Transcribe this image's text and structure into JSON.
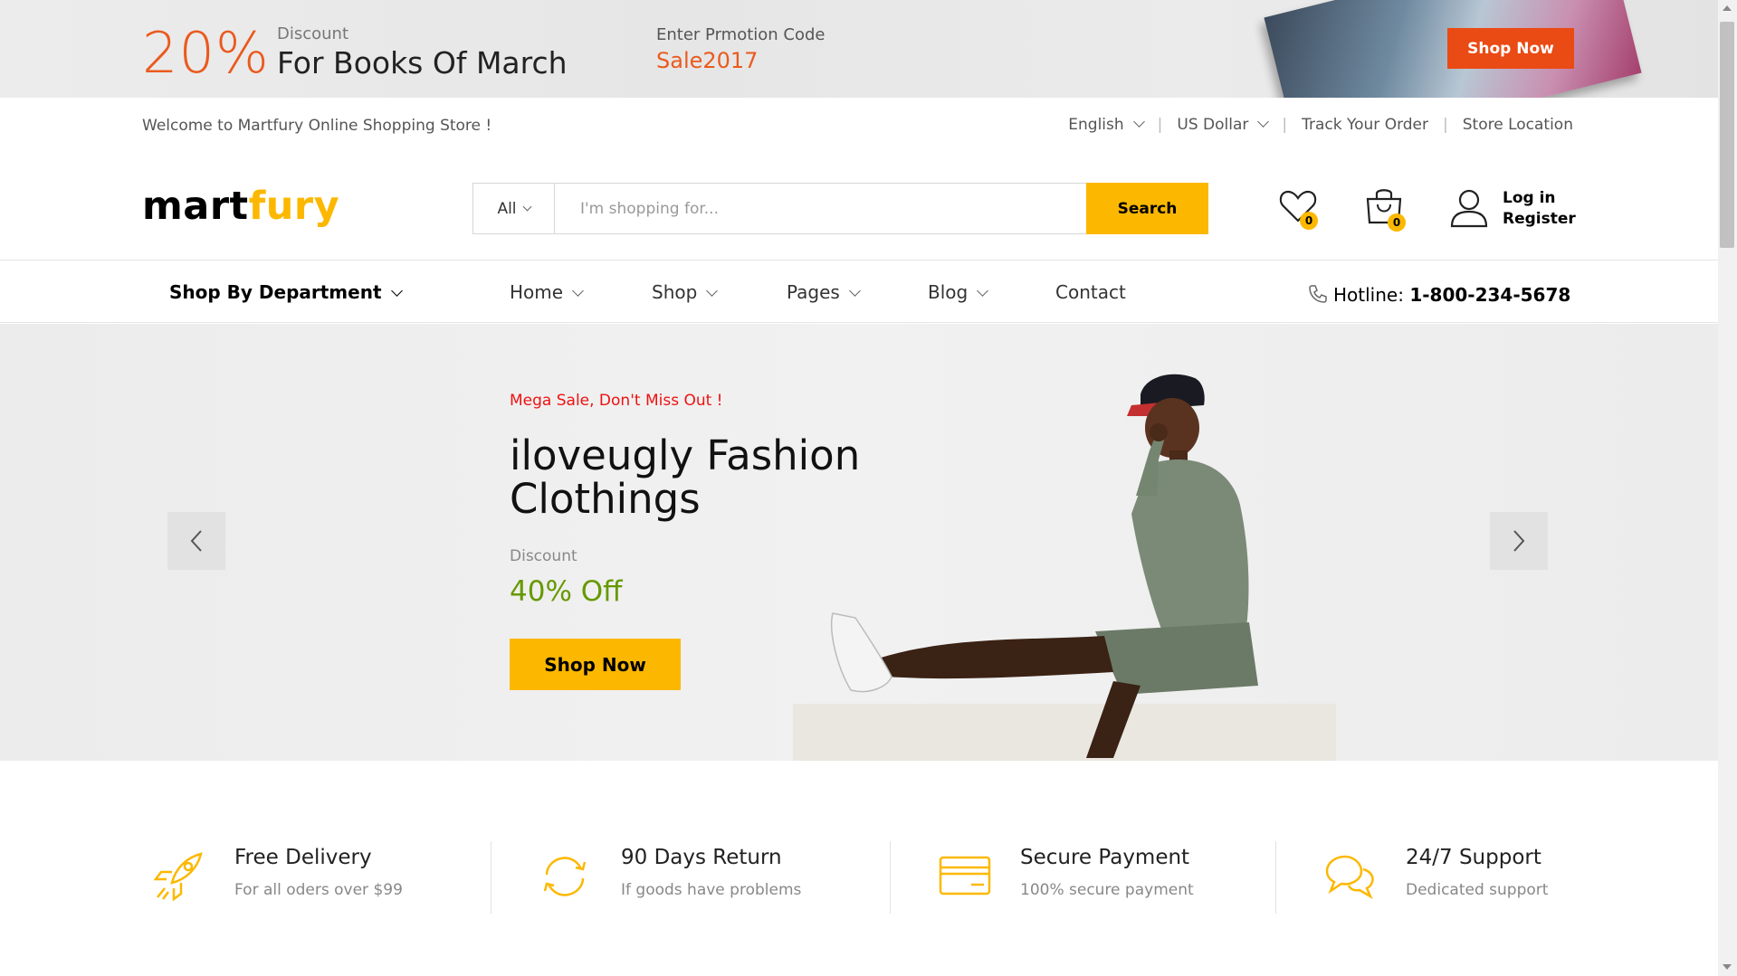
{
  "promo": {
    "percent": "20%",
    "discount_label": "Discount",
    "headline": "For Books Of March",
    "code_label": "Enter Prmotion Code",
    "code": "Sale2017",
    "button": "Shop Now"
  },
  "topbar": {
    "welcome": "Welcome to Martfury Online Shopping Store !",
    "language": "English",
    "currency": "US Dollar",
    "track": "Track Your Order",
    "store": "Store Location"
  },
  "header": {
    "logo_part1": "mart",
    "logo_part2": "fury",
    "search_category": "All",
    "search_placeholder": "I'm shopping for...",
    "search_button": "Search",
    "wishlist_count": "0",
    "cart_count": "0",
    "login": "Log in",
    "register": "Register"
  },
  "nav": {
    "department": "Shop By Department",
    "items": [
      "Home",
      "Shop",
      "Pages",
      "Blog",
      "Contact"
    ],
    "hotline_label": "Hotline:",
    "hotline_number": "1-800-234-5678"
  },
  "hero": {
    "tag": "Mega Sale, Don't Miss Out !",
    "title": "iloveugly Fashion Clothings",
    "discount_label": "Discount",
    "discount": "40% Off",
    "button": "Shop Now"
  },
  "features": [
    {
      "title": "Free Delivery",
      "sub": "For all oders over $99",
      "icon": "rocket-icon"
    },
    {
      "title": "90 Days Return",
      "sub": "If goods have problems",
      "icon": "refresh-icon"
    },
    {
      "title": "Secure Payment",
      "sub": "100% secure payment",
      "icon": "credit-card-icon"
    },
    {
      "title": "24/7 Support",
      "sub": "Dedicated support",
      "icon": "chat-icon"
    }
  ],
  "colors": {
    "accent": "#fcb800",
    "promo_orange": "#ea4a14",
    "sale_red": "#ee1111",
    "discount_green": "#669900"
  }
}
